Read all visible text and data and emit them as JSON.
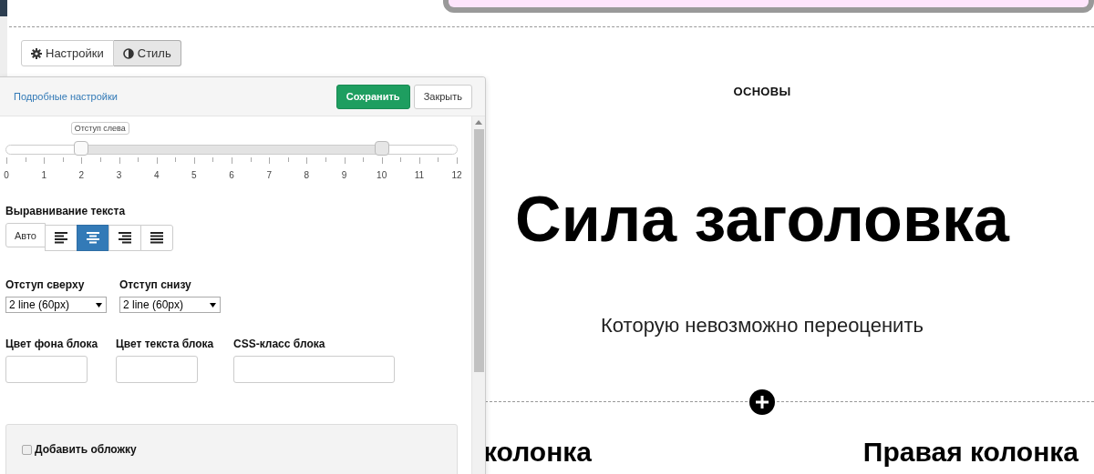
{
  "page": {
    "eyebrow": "ОСНОВЫ",
    "heading": "Сила заголовка",
    "subheading": "Которую невозможно переоценить",
    "columns": [
      "колонка",
      "Правая колонка"
    ]
  },
  "tabs": [
    {
      "label": "Настройки",
      "kind": "gear",
      "selected": false
    },
    {
      "label": "Стиль",
      "kind": "contrast",
      "selected": true
    }
  ],
  "panel": {
    "link": "Подробные настройки",
    "buttons": [
      {
        "label": "Сохранить",
        "kind": "primary"
      },
      {
        "label": "Закрыть",
        "kind": "default"
      }
    ],
    "slider": {
      "tooltip": "Отступ слева",
      "handles": [
        {
          "level": 0.1667
        },
        {
          "level": 0.8333
        }
      ],
      "ticks": [
        "0",
        "1",
        "2",
        "3",
        "4",
        "5",
        "6",
        "7",
        "8",
        "9",
        "10",
        "11",
        "12"
      ]
    },
    "alignment": {
      "label": "Выравнивание текста",
      "options": [
        {
          "kind": "text",
          "label": "Авто",
          "selected": false
        },
        {
          "kind": "left",
          "selected": false
        },
        {
          "kind": "center",
          "selected": true
        },
        {
          "kind": "right",
          "selected": false
        },
        {
          "kind": "justify",
          "selected": false
        }
      ]
    },
    "selects": [
      {
        "label": "Отступ сверху",
        "value": "2 line (60px)"
      },
      {
        "label": "Отступ снизу",
        "value": "2 line (60px)"
      }
    ],
    "inputs": [
      {
        "label": "Цвет фона блока"
      },
      {
        "label": "Цвет текста блока"
      },
      {
        "label": "CSS-класс блока"
      }
    ],
    "cover": {
      "label": "Добавить обложку",
      "checked": false
    }
  }
}
